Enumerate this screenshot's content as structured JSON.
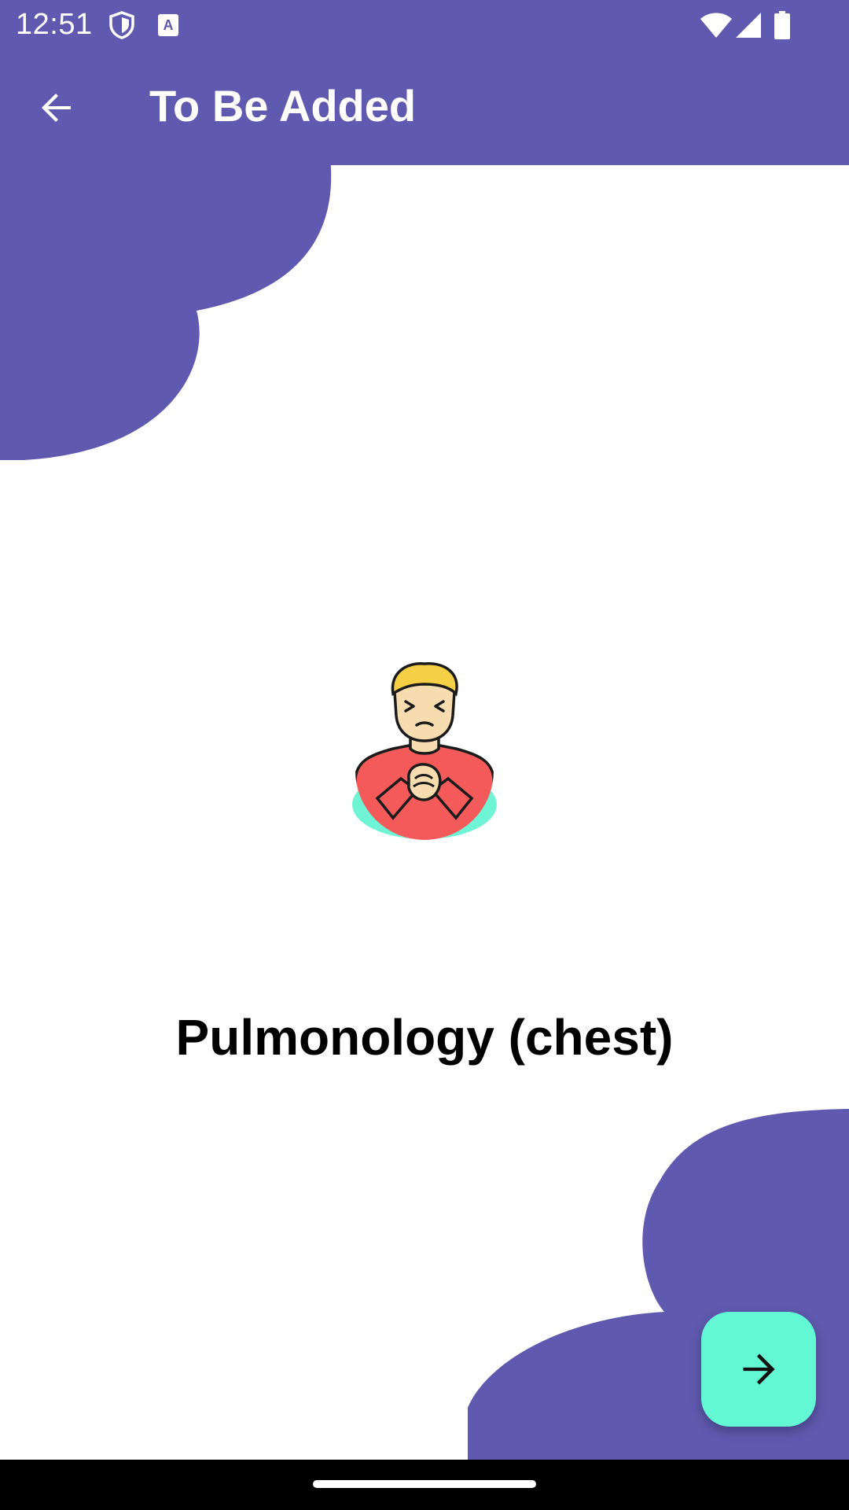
{
  "status_bar": {
    "time": "12:51",
    "left_icons": [
      "shield-icon",
      "font-a-icon"
    ],
    "right_icons": [
      "wifi-icon",
      "cellular-signal-icon",
      "battery-icon"
    ]
  },
  "app_bar": {
    "title": "To Be Added",
    "back_icon": "arrow-back-icon"
  },
  "content": {
    "illustration": "chest-pain-person-icon",
    "label": "Pulmonology (chest)"
  },
  "fab": {
    "icon": "arrow-forward-icon"
  },
  "colors": {
    "primary": "#5f5aaf",
    "accent": "#64f7d4",
    "background": "#ffffff",
    "nav_bar": "#000000"
  }
}
